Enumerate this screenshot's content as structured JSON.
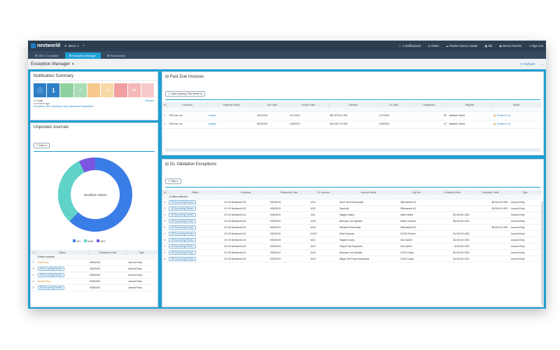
{
  "app": {
    "logo": "nextworld",
    "menu_label": "Menu"
  },
  "topbar": {
    "notifications": "1 Notifications",
    "roles": "Roles",
    "workspace": "Partner Demo Leader",
    "extra": "Bill",
    "user": "Demo Parente",
    "signout": "Sign Out"
  },
  "tabs": [
    {
      "label": "CEO / Controller"
    },
    {
      "label": "Exception Manager"
    },
    {
      "label": "Receivables"
    }
  ],
  "page": {
    "title": "Exception Manager",
    "refresh": "Refresh",
    "more": "..."
  },
  "notif": {
    "title": "Notification Summary",
    "kpi_value": "1",
    "item_title": "Close",
    "item_time": "a moment ago",
    "item_desc": "Exception: Item: Monthly Entry, Approvals Requested",
    "dismiss": "Dismiss"
  },
  "journals": {
    "title": "Unposted Journals",
    "filter": "Filter",
    "donut_label": "Workflow States",
    "legend": [
      {
        "label": "JE1",
        "color": "#3b7de6"
      },
      {
        "label": "NEW",
        "color": "#5fd3c8"
      },
      {
        "label": "NEG",
        "color": "#7b55e0"
      }
    ],
    "columns": [
      "Status",
      "Transaction Date",
      "Type"
    ],
    "filter_status": "5 filters selected",
    "rows": [
      {
        "status": "Draft Entry",
        "date": "6/28/2021",
        "type": "Journal Entry",
        "chip": false
      },
      {
        "status": "AR Accounting Review",
        "date": "8/28/2021",
        "type": "Journal Entry",
        "chip": true
      },
      {
        "status": "AR Accounting Review",
        "date": "8/28/2021",
        "type": "Journal Entry",
        "chip": true
      },
      {
        "status": "Needs Entry",
        "date": "8/28/2021",
        "type": "Journal Entry",
        "chip": false
      },
      {
        "status": "AR Accounting Review",
        "date": "8/28/2021",
        "type": "Journal Entry",
        "chip": true
      }
    ]
  },
  "invoices": {
    "title": "Past Due Invoices",
    "filter": "Lines Expiring This Month",
    "columns": [
      "Customer",
      "Payment Status",
      "Due Date",
      "Invoice Date",
      "Subtotal",
      "GL Date",
      "Transaction",
      "Register",
      "Status"
    ],
    "rows": [
      {
        "customer": "Tell Dms, Inc",
        "pay": "Unpaid",
        "due": "6/04/2021",
        "inv": "1/17/2021",
        "sub": "$87,378.00 USD",
        "gl": "1/17/2021",
        "txn": "50",
        "reg": "Balance Sheet",
        "status": "Posted to GL"
      },
      {
        "customer": "Tell Dms, Inc",
        "pay": "Unpaid",
        "due": "6/04/2021",
        "inv": "1/26/2021",
        "sub": "$41,900.73 USD",
        "gl": "1/26/2021",
        "txn": "47",
        "reg": "Balance Sheet",
        "status": "Posted to GL"
      }
    ]
  },
  "gl": {
    "title": "GL Validation Exceptions",
    "filter": "Filter",
    "columns": [
      "Status",
      "Company",
      "Transaction Date",
      "GL Account",
      "Account Name",
      "Org Unit",
      "Company Debit",
      "Company Credit",
      "Type"
    ],
    "filter_status": "14 filters selected",
    "rows": [
      {
        "company": "20 US Nextworld US",
        "date": "9/30/2019",
        "acct": "1010",
        "name": "Short Term Receivable",
        "org": "Officeworld US",
        "debit": "",
        "credit": "$5,000.00 USD"
      },
      {
        "company": "20 US Nextworld US",
        "date": "9/30/2019",
        "acct": "1020",
        "name": "Deposits",
        "org": "Officeworld US",
        "debit": "",
        "credit": "$1,000.00 USD"
      },
      {
        "company": "20 US Nextworld US",
        "date": "9/30/2019",
        "acct": "1021",
        "name": "Wages Salary",
        "org": "Sales Writer",
        "debit": "$2,000.00 USD",
        "credit": ""
      },
      {
        "company": "20 US Nextworld US",
        "date": "9/30/2019",
        "acct": "1030",
        "name": "Bonuses Job Specific",
        "org": "Sales Contract",
        "debit": "$5,000.00 USD",
        "credit": ""
      },
      {
        "company": "20 US Nextworld US",
        "date": "9/30/2019",
        "acct": "1040",
        "name": "Rebates Receivable",
        "org": "Officeworld US",
        "debit": "",
        "credit": "$5,000.00 USD"
      },
      {
        "company": "20 US Nextworld US",
        "date": "9/30/2019",
        "acct": "41310",
        "name": "Rent Expense",
        "org": "COGS Portion",
        "debit": "$1,000.00 USD",
        "credit": ""
      },
      {
        "company": "20 US Nextworld US",
        "date": "9/30/2019",
        "acct": "1011",
        "name": "Wages Hourly",
        "org": "Gen Admin",
        "debit": "$2,000.00 USD",
        "credit": ""
      },
      {
        "company": "20 US Nextworld US",
        "date": "9/30/2019",
        "acct": "1012",
        "name": "Payroll Tax Expenses",
        "org": "Gen Admin",
        "debit": "$,000.00 USD",
        "credit": ""
      },
      {
        "company": "20 US Nextworld US",
        "date": "9/30/2019",
        "acct": "1013",
        "name": "Bonuses Job Specific",
        "org": "COGS Labor",
        "debit": "$2,000.00 USD",
        "credit": ""
      },
      {
        "company": "20 US Nextworld US",
        "date": "9/30/2019",
        "acct": "1014",
        "name": "Wage Cell Phone Allowance",
        "org": "COGS Labor",
        "debit": "$1,000.00 USD",
        "credit": ""
      }
    ],
    "chip": "AR Accounting Review",
    "type": "Journal Entry"
  }
}
